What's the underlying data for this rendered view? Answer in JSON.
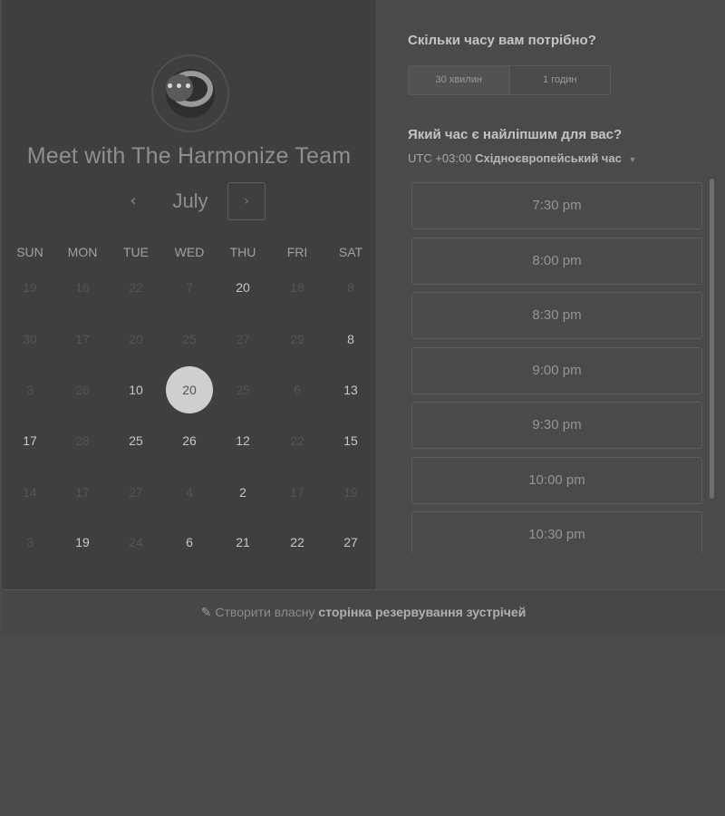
{
  "scheduler": {
    "title": "Meet with The Harmonize Team",
    "logo_dots": "•••"
  },
  "calendar": {
    "month": "July",
    "prev_icon": "‹",
    "next_icon": "›",
    "weekdays": [
      "SUN",
      "MON",
      "TUE",
      "WED",
      "THU",
      "FRI",
      "SAT"
    ],
    "weeks": [
      [
        "19",
        "16",
        "22",
        "7",
        "20",
        "18",
        "8"
      ],
      [
        "30",
        "17",
        "20",
        "25",
        "27",
        "29",
        "8"
      ],
      [
        "3",
        "26",
        "10",
        "20",
        "25",
        "6",
        "13"
      ],
      [
        "17",
        "28",
        "25",
        "26",
        "12",
        "22",
        "15"
      ],
      [
        "14",
        "17",
        "27",
        "4",
        "2",
        "17",
        "19"
      ],
      [
        "3",
        "19",
        "24",
        "6",
        "21",
        "22",
        "27"
      ]
    ],
    "available": [
      [
        false,
        false,
        false,
        false,
        true,
        false,
        false
      ],
      [
        false,
        false,
        false,
        false,
        false,
        false,
        true
      ],
      [
        false,
        false,
        true,
        true,
        false,
        false,
        true
      ],
      [
        true,
        false,
        true,
        true,
        true,
        false,
        true
      ],
      [
        false,
        false,
        false,
        false,
        true,
        false,
        false
      ],
      [
        false,
        true,
        false,
        true,
        true,
        true,
        true
      ]
    ],
    "selected": "20"
  },
  "booking": {
    "duration_question": "Скільки часу вам потрібно?",
    "durations": [
      "30 хвилин",
      "1 годин"
    ],
    "time_question": "Який час є найліпшим для вас?",
    "timezone_offset": "UTC +03:00",
    "timezone_name": "Східноєвропейський час",
    "timezone_caret": "▼",
    "slots": [
      "7:30 pm",
      "8:00 pm",
      "8:30 pm",
      "9:00 pm",
      "9:30 pm",
      "10:00 pm",
      "10:30 pm"
    ]
  },
  "footer": {
    "icon": "✎",
    "prefix": "Створити власну",
    "link": "сторінка резервування зустрічей"
  }
}
